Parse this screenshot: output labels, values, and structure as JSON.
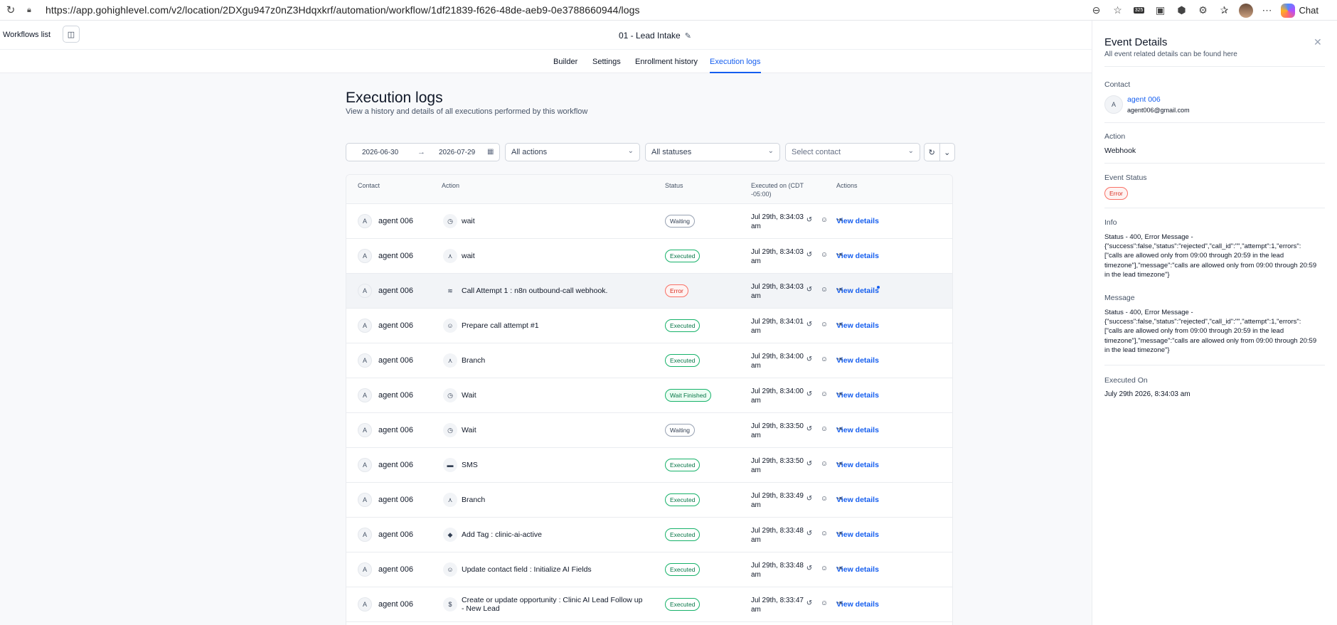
{
  "browser": {
    "url": "https://app.gohighlevel.com/v2/location/2DXgu947z0nZ3Hdqxkrf/automation/workflow/1df21839-f626-48de-aeb9-0e3788660944/logs",
    "chat_label": "Chat",
    "extension_badge": "325"
  },
  "header": {
    "workflows_list": "Workflows list",
    "workflow_title": "01 - Lead Intake"
  },
  "tabs": [
    {
      "label": "Builder"
    },
    {
      "label": "Settings"
    },
    {
      "label": "Enrollment history"
    },
    {
      "label": "Execution logs"
    }
  ],
  "main": {
    "title": "Execution logs",
    "subtitle": "View a history and details of all executions performed by this workflow"
  },
  "filters": {
    "date_from": "2026-06-30",
    "date_to": "2026-07-29",
    "actions": "All actions",
    "statuses": "All statuses",
    "contact_placeholder": "Select contact"
  },
  "table": {
    "columns": {
      "contact": "Contact",
      "action": "Action",
      "status": "Status",
      "executed_on": "Executed on (CDT -05:00)",
      "actions": "Actions"
    },
    "view_label": "View details",
    "rows": [
      {
        "avatar": "A",
        "contact": "agent 006",
        "icon": "clock-icon",
        "action": "wait",
        "status": "Waiting",
        "kind": "waiting",
        "time": "Jul 29th, 8:34:03 am"
      },
      {
        "avatar": "A",
        "contact": "agent 006",
        "icon": "branch-icon",
        "action": "wait",
        "status": "Executed",
        "kind": "executed",
        "time": "Jul 29th, 8:34:03 am"
      },
      {
        "avatar": "A",
        "contact": "agent 006",
        "icon": "webhook-icon",
        "action": "Call Attempt 1 : n8n outbound-call webhook.",
        "status": "Error",
        "kind": "error",
        "time": "Jul 29th, 8:34:03 am"
      },
      {
        "avatar": "A",
        "contact": "agent 006",
        "icon": "user-edit-icon",
        "action": "Prepare call attempt #1",
        "status": "Executed",
        "kind": "executed",
        "time": "Jul 29th, 8:34:01 am"
      },
      {
        "avatar": "A",
        "contact": "agent 006",
        "icon": "branch-icon",
        "action": "Branch",
        "status": "Executed",
        "kind": "executed",
        "time": "Jul 29th, 8:34:00 am"
      },
      {
        "avatar": "A",
        "contact": "agent 006",
        "icon": "clock-icon",
        "action": "Wait",
        "status": "Wait Finished",
        "kind": "finished",
        "time": "Jul 29th, 8:34:00 am"
      },
      {
        "avatar": "A",
        "contact": "agent 006",
        "icon": "clock-icon",
        "action": "Wait",
        "status": "Waiting",
        "kind": "waiting",
        "time": "Jul 29th, 8:33:50 am"
      },
      {
        "avatar": "A",
        "contact": "agent 006",
        "icon": "message-icon",
        "action": "SMS",
        "status": "Executed",
        "kind": "executed",
        "time": "Jul 29th, 8:33:50 am"
      },
      {
        "avatar": "A",
        "contact": "agent 006",
        "icon": "branch-icon",
        "action": "Branch",
        "status": "Executed",
        "kind": "executed",
        "time": "Jul 29th, 8:33:49 am"
      },
      {
        "avatar": "A",
        "contact": "agent 006",
        "icon": "tag-icon",
        "action": "Add Tag : clinic-ai-active",
        "status": "Executed",
        "kind": "executed",
        "time": "Jul 29th, 8:33:48 am"
      },
      {
        "avatar": "A",
        "contact": "agent 006",
        "icon": "user-edit-icon",
        "action": "Update contact field : Initialize AI Fields",
        "status": "Executed",
        "kind": "executed",
        "time": "Jul 29th, 8:33:48 am"
      },
      {
        "avatar": "A",
        "contact": "agent 006",
        "icon": "dollar-icon",
        "action": "Create or update opportunity : Clinic AI Lead Follow up - New Lead",
        "status": "Executed",
        "kind": "executed",
        "time": "Jul 29th, 8:33:47 am"
      }
    ]
  },
  "panel": {
    "title": "Event Details",
    "subtitle": "All event related details can be found here",
    "contact_label": "Contact",
    "contact_avatar": "A",
    "contact_name": "agent 006",
    "contact_email": "agent006@gmail.com",
    "action_label": "Action",
    "action_value": "Webhook",
    "status_label": "Event Status",
    "status_value": "Error",
    "info_label": "Info",
    "info_value": "Status - 400, Error Message - {\"success\":false,\"status\":\"rejected\",\"call_id\":\"\",\"attempt\":1,\"errors\":[\"calls are allowed only from 09:00 through 20:59 in the lead timezone\"],\"message\":\"calls are allowed only from 09:00 through 20:59 in the lead timezone\"}",
    "message_label": "Message",
    "message_value": "Status - 400, Error Message - {\"success\":false,\"status\":\"rejected\",\"call_id\":\"\",\"attempt\":1,\"errors\":[\"calls are allowed only from 09:00 through 20:59 in the lead timezone\"],\"message\":\"calls are allowed only from 09:00 through 20:59 in the lead timezone\"}",
    "executed_label": "Executed On",
    "executed_value": "July 29th 2026, 8:34:03 am"
  }
}
